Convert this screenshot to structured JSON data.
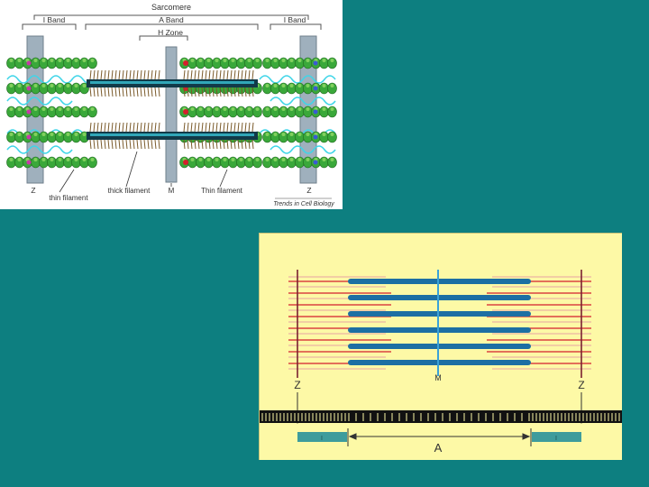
{
  "colors": {
    "background": "#0d7f80",
    "top_panel": "#ffffff",
    "bottom_panel": "#fdf9a6",
    "z_disc": "#9fb0bd",
    "actin_green": "#3aa83a",
    "titin_cyan": "#3fd5e8",
    "myosin_dark": "#123a48",
    "thin_red": "#d41f2c",
    "thick_blue": "#1d6fa3",
    "i_band_box": "#3e9c9c"
  },
  "top_diagram": {
    "sarcomere_label": "Sarcomere",
    "i_band_left": "I Band",
    "a_band": "A Band",
    "i_band_right": "I Band",
    "h_zone": "H Zone",
    "z_left": "Z",
    "thin_filament_left": "thin filament",
    "thick_filament": "thick filament",
    "m_line": "M",
    "thin_filament_right": "Thin filament",
    "z_right": "Z",
    "credit": "Trends in Cell Biology"
  },
  "bottom_diagram": {
    "z_left": "Z",
    "m_line": "M",
    "z_right": "Z",
    "i_left": "I",
    "a_band": "A",
    "i_right": "I"
  }
}
